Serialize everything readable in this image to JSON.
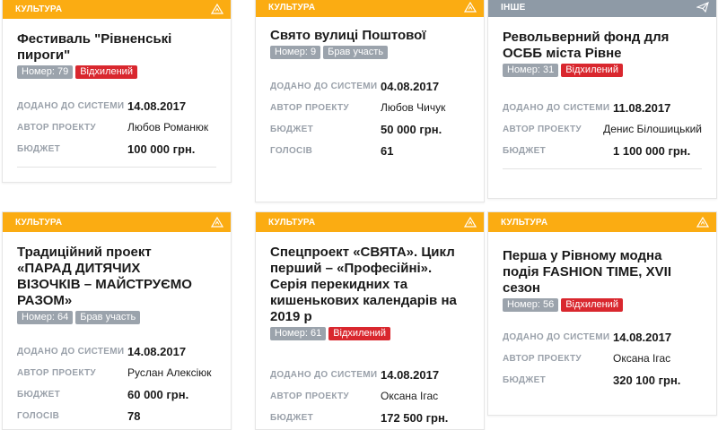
{
  "colors": {
    "culture": "#fbac12",
    "other": "#8e9aa6",
    "rejected": "#d9272e",
    "badge": "#9ba3ac"
  },
  "labels": {
    "added": "ДОДАНО ДО СИСТЕМИ",
    "author": "АВТОР ПРОЕКТУ",
    "budget": "БЮДЖЕТ",
    "votes": "ГОЛОСІВ"
  },
  "cards": [
    {
      "category": "КУЛЬТУРА",
      "icon": "warning-triangle-icon",
      "title": "Фестиваль \"Рівненські пироги\"",
      "number": "Номер: 79",
      "status": "Відхилений",
      "added": "14.08.2017",
      "author": "Любов Романюк",
      "budget": "100 000 грн."
    },
    {
      "category": "КУЛЬТУРА",
      "icon": "warning-triangle-icon",
      "title": "Свято вулиці Поштової",
      "number": "Номер: 9",
      "status": "Брав участь",
      "added": "04.08.2017",
      "author": "Любов Чичук",
      "budget": "50 000 грн.",
      "votes": "61"
    },
    {
      "category": "ІНШЕ",
      "icon": "paper-plane-icon",
      "title": "Револьверний фонд для ОСББ міста Рівне",
      "number": "Номер: 31",
      "status": "Відхилений",
      "added": "11.08.2017",
      "author": "Денис Білошицький",
      "budget": "1 100 000 грн."
    },
    {
      "category": "КУЛЬТУРА",
      "icon": "warning-triangle-icon",
      "title": "Традиційний проект «ПАРАД ДИТЯЧИХ ВІЗОЧКІВ – МАЙСТРУЄМО РАЗОМ»",
      "number": "Номер: 64",
      "status": "Брав участь",
      "added": "14.08.2017",
      "author": "Руслан Алексіюк",
      "budget": "60 000 грн.",
      "votes": "78"
    },
    {
      "category": "КУЛЬТУРА",
      "icon": "warning-triangle-icon",
      "title": "Спецпроект «СВЯТА». Цикл перший – «Професійні». Серія перекидних та кишенькових календарів на 2019 р",
      "number": "Номер: 61",
      "status": "Відхилений",
      "added": "14.08.2017",
      "author": "Оксана Ігас",
      "budget": "172 500 грн."
    },
    {
      "category": "КУЛЬТУРА",
      "icon": "warning-triangle-icon",
      "title": "Перша у Рівному модна подія FASHION TIME, XVII сезон",
      "number": "Номер: 56",
      "status": "Відхилений",
      "added": "14.08.2017",
      "author": "Оксана Ігас",
      "budget": "320 100 грн."
    }
  ]
}
